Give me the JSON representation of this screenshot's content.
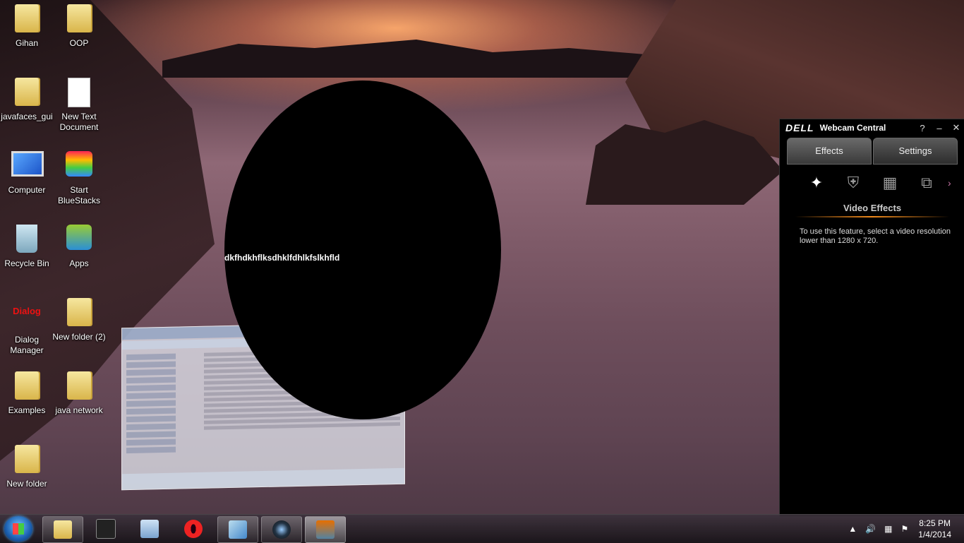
{
  "desktop": {
    "icons": [
      {
        "label": "Gihan",
        "icon": "user-folder-icon"
      },
      {
        "label": "OOP",
        "icon": "folder-icon"
      },
      {
        "label": "javafaces_gui",
        "icon": "folder-icon"
      },
      {
        "label": "New Text Document",
        "icon": "text-document-icon"
      },
      {
        "label": "Computer",
        "icon": "computer-icon"
      },
      {
        "label": "Start BlueStacks",
        "icon": "bluestacks-icon"
      },
      {
        "label": "Recycle Bin",
        "icon": "recycle-bin-icon"
      },
      {
        "label": "Apps",
        "icon": "android-apps-icon"
      },
      {
        "label": "Dialog Manager",
        "icon": "dialog-icon"
      },
      {
        "label": "New folder (2)",
        "icon": "folder-icon"
      },
      {
        "label": "Examples",
        "icon": "folder-icon"
      },
      {
        "label": "java network",
        "icon": "folder-icon"
      },
      {
        "label": "New folder",
        "icon": "folder-icon"
      }
    ],
    "dialog_logo_text": "Dialog",
    "overlay_text": "dkfhdkhflksdhklfdhlkfslkhfld"
  },
  "dell": {
    "logo": "DELL",
    "title": "Webcam Central",
    "controls": {
      "help": "?",
      "minimize": "–",
      "close": "✕"
    },
    "tabs": [
      "Effects",
      "Settings"
    ],
    "section_title": "Video Effects",
    "message": "To use this feature, select a video resolution lower than 1280 x 720.",
    "accent_color": "#f08a1c"
  },
  "taskbar": {
    "time": "8:25 PM",
    "date": "1/4/2014",
    "pinned": [
      "file-explorer-icon",
      "media-icon",
      "calculator-icon",
      "opera-icon",
      "virtualbox-icon",
      "webcam-icon",
      "java-icon"
    ]
  }
}
